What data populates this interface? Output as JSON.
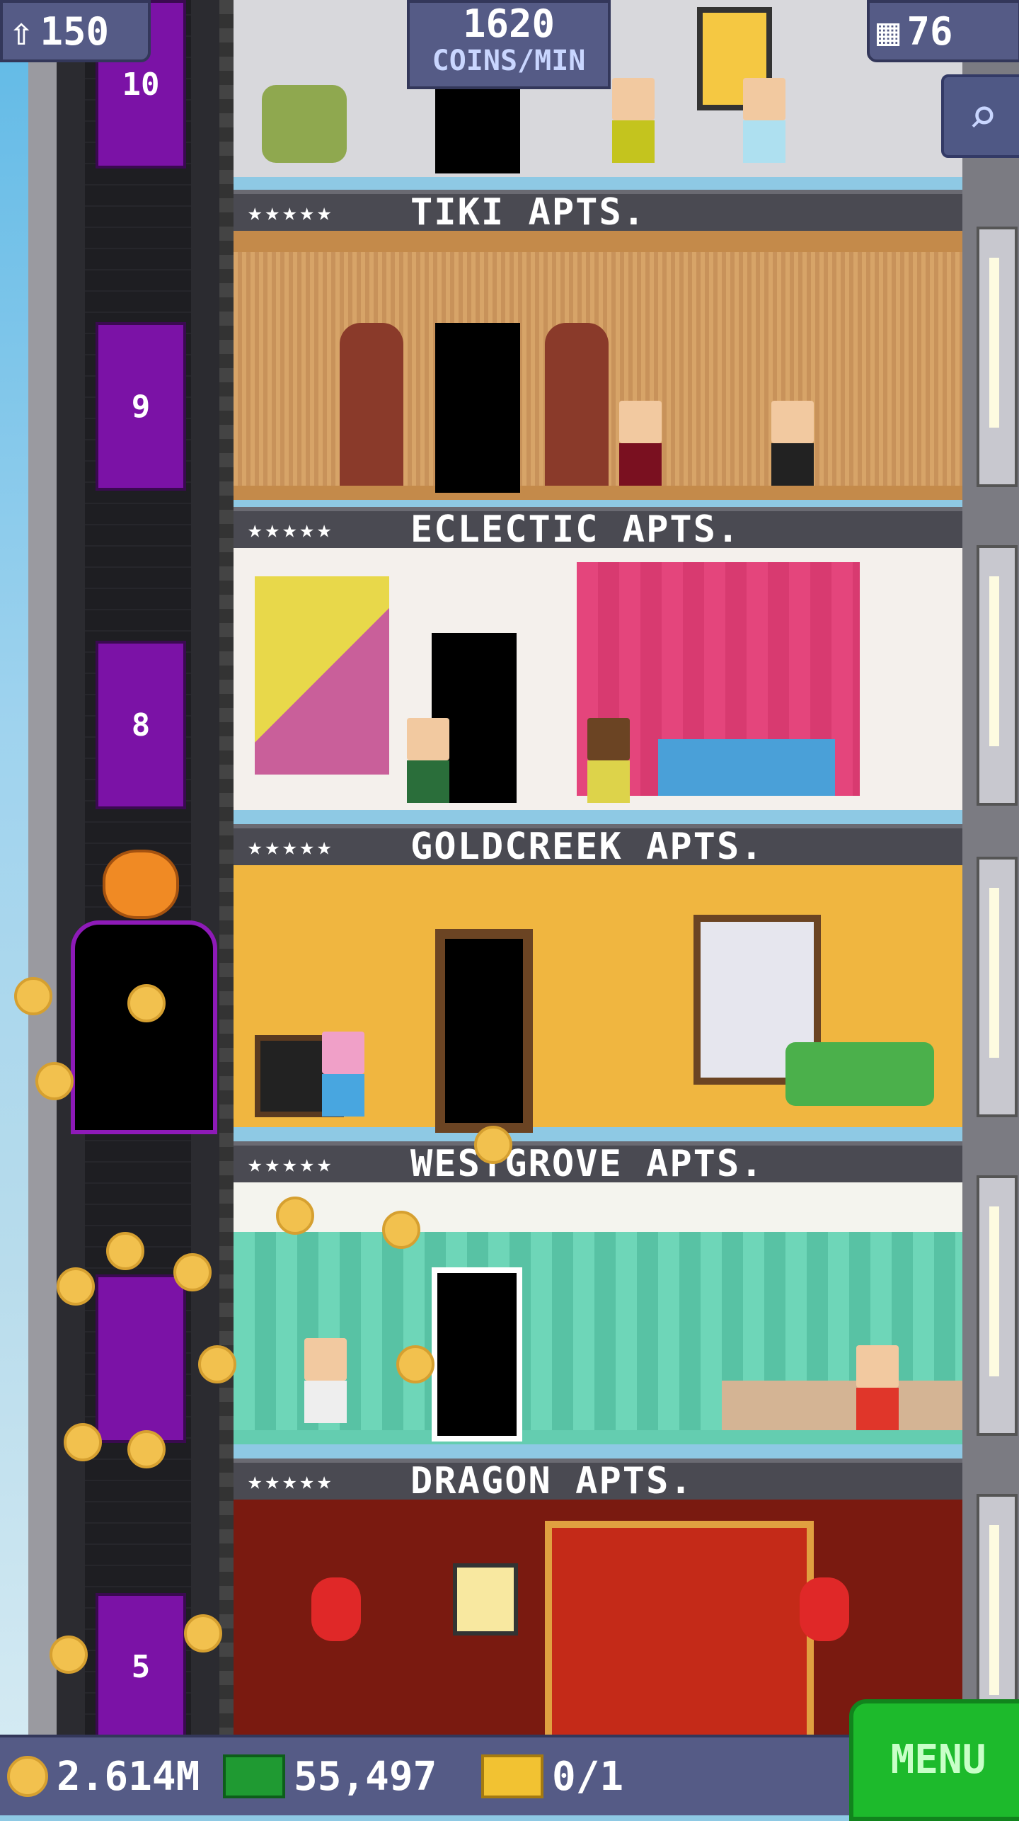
{
  "top_hud": {
    "population": "150",
    "coins_per_min_value": "1620",
    "coins_per_min_label": "COINS/MIN",
    "floors": "76"
  },
  "floors": [
    {
      "name": "TIKI APTS.",
      "stars": "★★★★★",
      "elevator_number": "9"
    },
    {
      "name": "ECLECTIC APTS.",
      "stars": "★★★★★",
      "elevator_number": "8"
    },
    {
      "name": "GOLDCREEK APTS.",
      "stars": "★★★★★"
    },
    {
      "name": "WESTGROVE APTS.",
      "stars": "★★★★★"
    },
    {
      "name": "DRAGON APTS.",
      "stars": "★★★★★",
      "elevator_number": "5"
    }
  ],
  "top_elevator_number": "10",
  "bottom_bar": {
    "coins": "2.614M",
    "bux": "55,497",
    "chests": "0/1",
    "menu_label": "MENU"
  },
  "colors": {
    "hud_bg": "#555b86",
    "menu_green": "#1dba2c",
    "elevator_purple": "#7b12a6",
    "coin_gold": "#f2c14e"
  }
}
